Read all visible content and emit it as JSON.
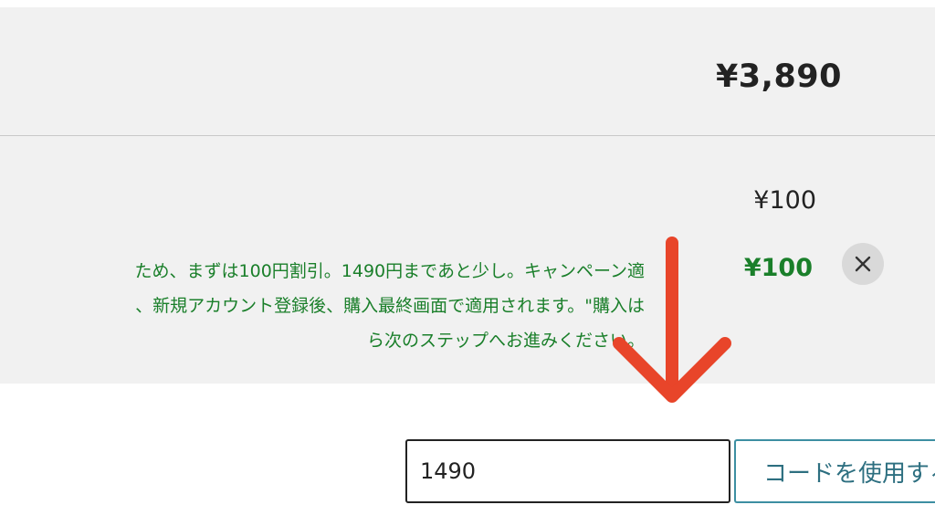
{
  "summary": {
    "total": "¥3,890",
    "discount_price": "¥100",
    "discount_amount": "¥100",
    "promo_message_lines": [
      "ため、まずは100円割引。1490円まであと少し。キャンペーン適",
      "、新規アカウント登録後、購入最終画面で適用されます。\"購入は",
      "ら次のステップへお進みください。"
    ],
    "remove_icon": "close-icon"
  },
  "promo_code": {
    "value": "1490",
    "placeholder": ""
  },
  "apply_button": {
    "label": "コードを使用する"
  },
  "annotation": {
    "icon": "arrow-down-icon",
    "color": "#e8452a"
  },
  "colors": {
    "panel_bg": "#f1f1f1",
    "discount_green": "#1a7f2a",
    "button_teal": "#2d6f80"
  }
}
